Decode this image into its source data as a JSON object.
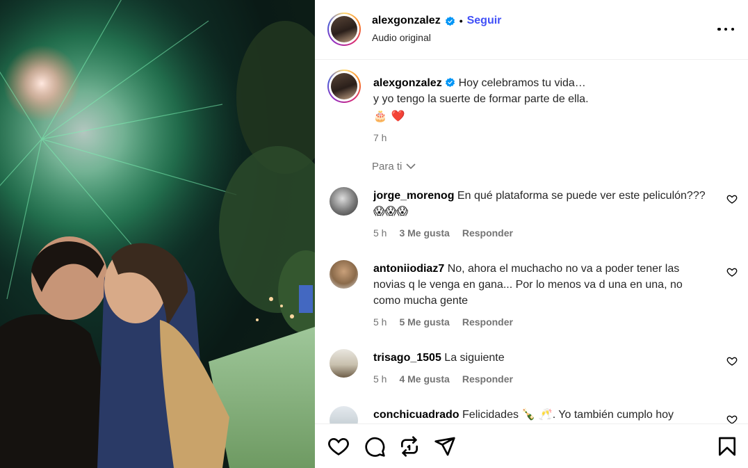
{
  "post": {
    "username": "alexgonzalez",
    "follow_label": "Seguir",
    "separator": "•",
    "audio": "Audio original",
    "caption_line1": "Hoy celebramos tu vida…",
    "caption_line2": "y yo tengo la suerte de formar parte de ella.",
    "caption_emojis": [
      "🎂",
      "❤️"
    ],
    "time": "7 h"
  },
  "comments_header": "Para ti",
  "comments": [
    {
      "user": "jorge_morenog",
      "text": "En qué plataforma se puede ver este peliculón??? 😱😱😱",
      "time": "5 h",
      "likes": "3 Me gusta",
      "reply": "Responder"
    },
    {
      "user": "antoniiodiaz7",
      "text": "No, ahora el muchacho no va a poder tener las novias q le venga en gana... Por lo menos va d una en una, no como mucha gente",
      "time": "5 h",
      "likes": "5 Me gusta",
      "reply": "Responder"
    },
    {
      "user": "trisago_1505",
      "text": "La siguiente",
      "time": "5 h",
      "likes": "4 Me gusta",
      "reply": "Responder"
    },
    {
      "user": "conchicuadrado",
      "text": "Felicidades 🍾 🥂. Yo también cumplo hoy",
      "time": "",
      "likes": "",
      "reply": ""
    }
  ],
  "colors": {
    "follow": "#4150f7",
    "verified": "#0095f6",
    "muted": "#737373"
  },
  "icons": {
    "like": "heart-icon",
    "comment": "comment-icon",
    "share": "repost-icon",
    "send": "send-icon",
    "save": "bookmark-icon"
  }
}
